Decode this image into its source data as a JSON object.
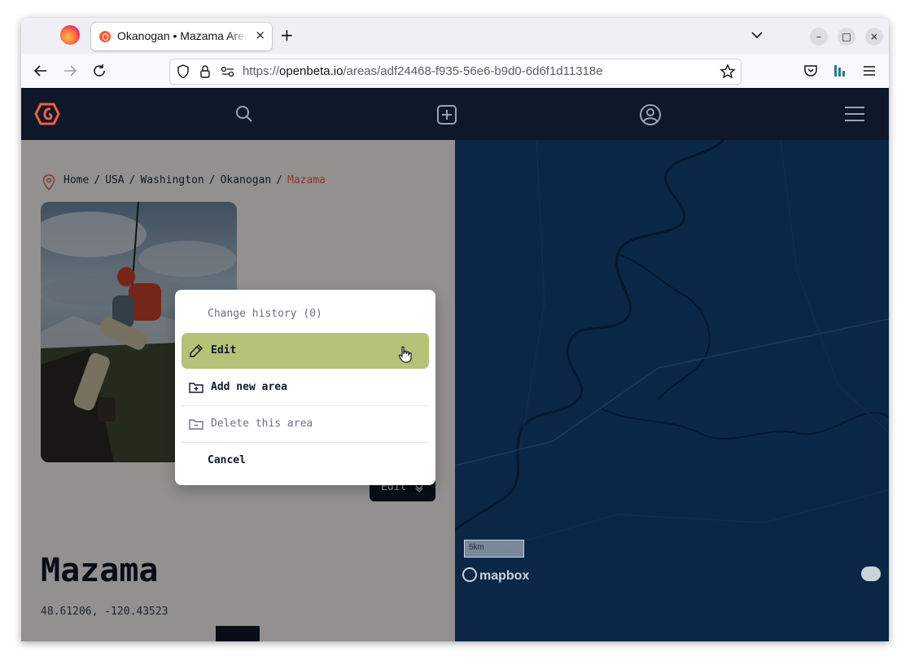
{
  "browser": {
    "tab": {
      "title": "Okanogan • Mazama Area",
      "close": "×"
    },
    "new_tab": "+",
    "url": {
      "scheme": "https://",
      "host": "openbeta.io",
      "path": "/areas/adf24468-f935-56e6-b9d0-6d6f1d11318e"
    },
    "window_controls": {
      "minimize": "–",
      "maximize": "□",
      "close": "×"
    }
  },
  "breadcrumb": {
    "items": [
      "Home",
      "USA",
      "Washington",
      "Okanogan"
    ],
    "current": "Mazama",
    "separator": "/"
  },
  "edit_dropdown": {
    "label": "Edit"
  },
  "area": {
    "title": "Mazama",
    "coordinates": "48.61206, -120.43523"
  },
  "menu": {
    "change_history": "Change history (0)",
    "edit": "Edit",
    "add_new_area": "Add new area",
    "delete_area": "Delete this area",
    "cancel": "Cancel"
  },
  "map": {
    "scale": "5km",
    "attribution_logo": "mapbox"
  },
  "colors": {
    "header_bg": "#0f172a",
    "accent": "#f15e40",
    "menu_highlight": "#b5c277",
    "map_bg": "#0b2748"
  }
}
